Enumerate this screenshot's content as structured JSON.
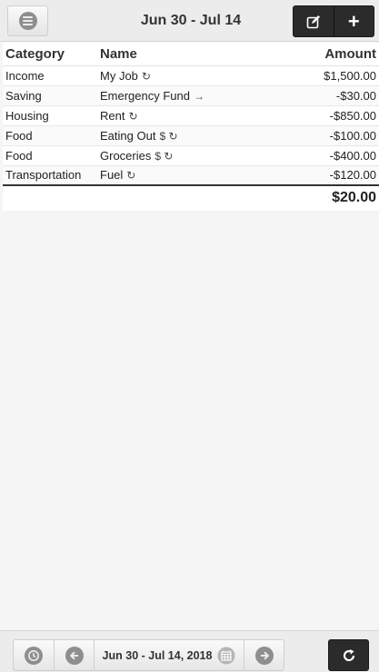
{
  "header": {
    "title": "Jun 30 - Jul 14",
    "menu_icon": "menu-icon",
    "edit_icon": "edit-icon",
    "add_icon": "plus-icon"
  },
  "table": {
    "headers": {
      "category": "Category",
      "name": "Name",
      "amount": "Amount"
    },
    "rows": [
      {
        "category": "Income",
        "name": "My Job",
        "icons": "↻",
        "amount": "$1,500.00"
      },
      {
        "category": "Saving",
        "name": "Emergency Fund",
        "icons": "→",
        "amount": "-$30.00"
      },
      {
        "category": "Housing",
        "name": "Rent",
        "icons": "↻",
        "amount": "-$850.00"
      },
      {
        "category": "Food",
        "name": "Eating Out",
        "icons": "$ ↻",
        "amount": "-$100.00"
      },
      {
        "category": "Food",
        "name": "Groceries",
        "icons": "$ ↻",
        "amount": "-$400.00"
      },
      {
        "category": "Transportation",
        "name": "Fuel",
        "icons": "↻",
        "amount": "-$120.00"
      }
    ],
    "total": "$20.00"
  },
  "footer": {
    "date_range": "Jun 30 - Jul 14, 2018",
    "history_icon": "clock-icon",
    "prev_icon": "arrow-left-icon",
    "calendar_icon": "calendar-icon",
    "next_icon": "arrow-right-icon",
    "refresh_icon": "refresh-icon"
  },
  "colors": {
    "dark_button": "#2b2b2b",
    "toolbar_bg": "#ececec",
    "icon_gray": "#8e8e8e"
  }
}
